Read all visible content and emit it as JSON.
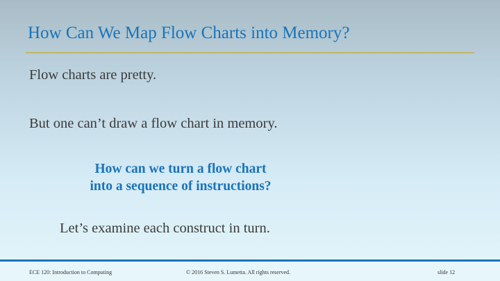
{
  "slide": {
    "title": "How Can We Map Flow Charts into Memory?",
    "line1": "Flow charts are pretty.",
    "line2": "But one can’t draw a flow chart in memory.",
    "callout": [
      "How can we turn a flow chart",
      "into a sequence of instructions?"
    ],
    "line3": "Let’s examine each construct in turn."
  },
  "footer": {
    "course": "ECE 120: Introduction to Computing",
    "copyright": "© 2016 Steven S. Lumetta.  All rights reserved.",
    "slide_number": "slide 12"
  },
  "colors": {
    "title": "#1a73b8",
    "rule": "#c2b66a",
    "body": "#3a3a3a",
    "footer_bar": "#1a73b8"
  }
}
